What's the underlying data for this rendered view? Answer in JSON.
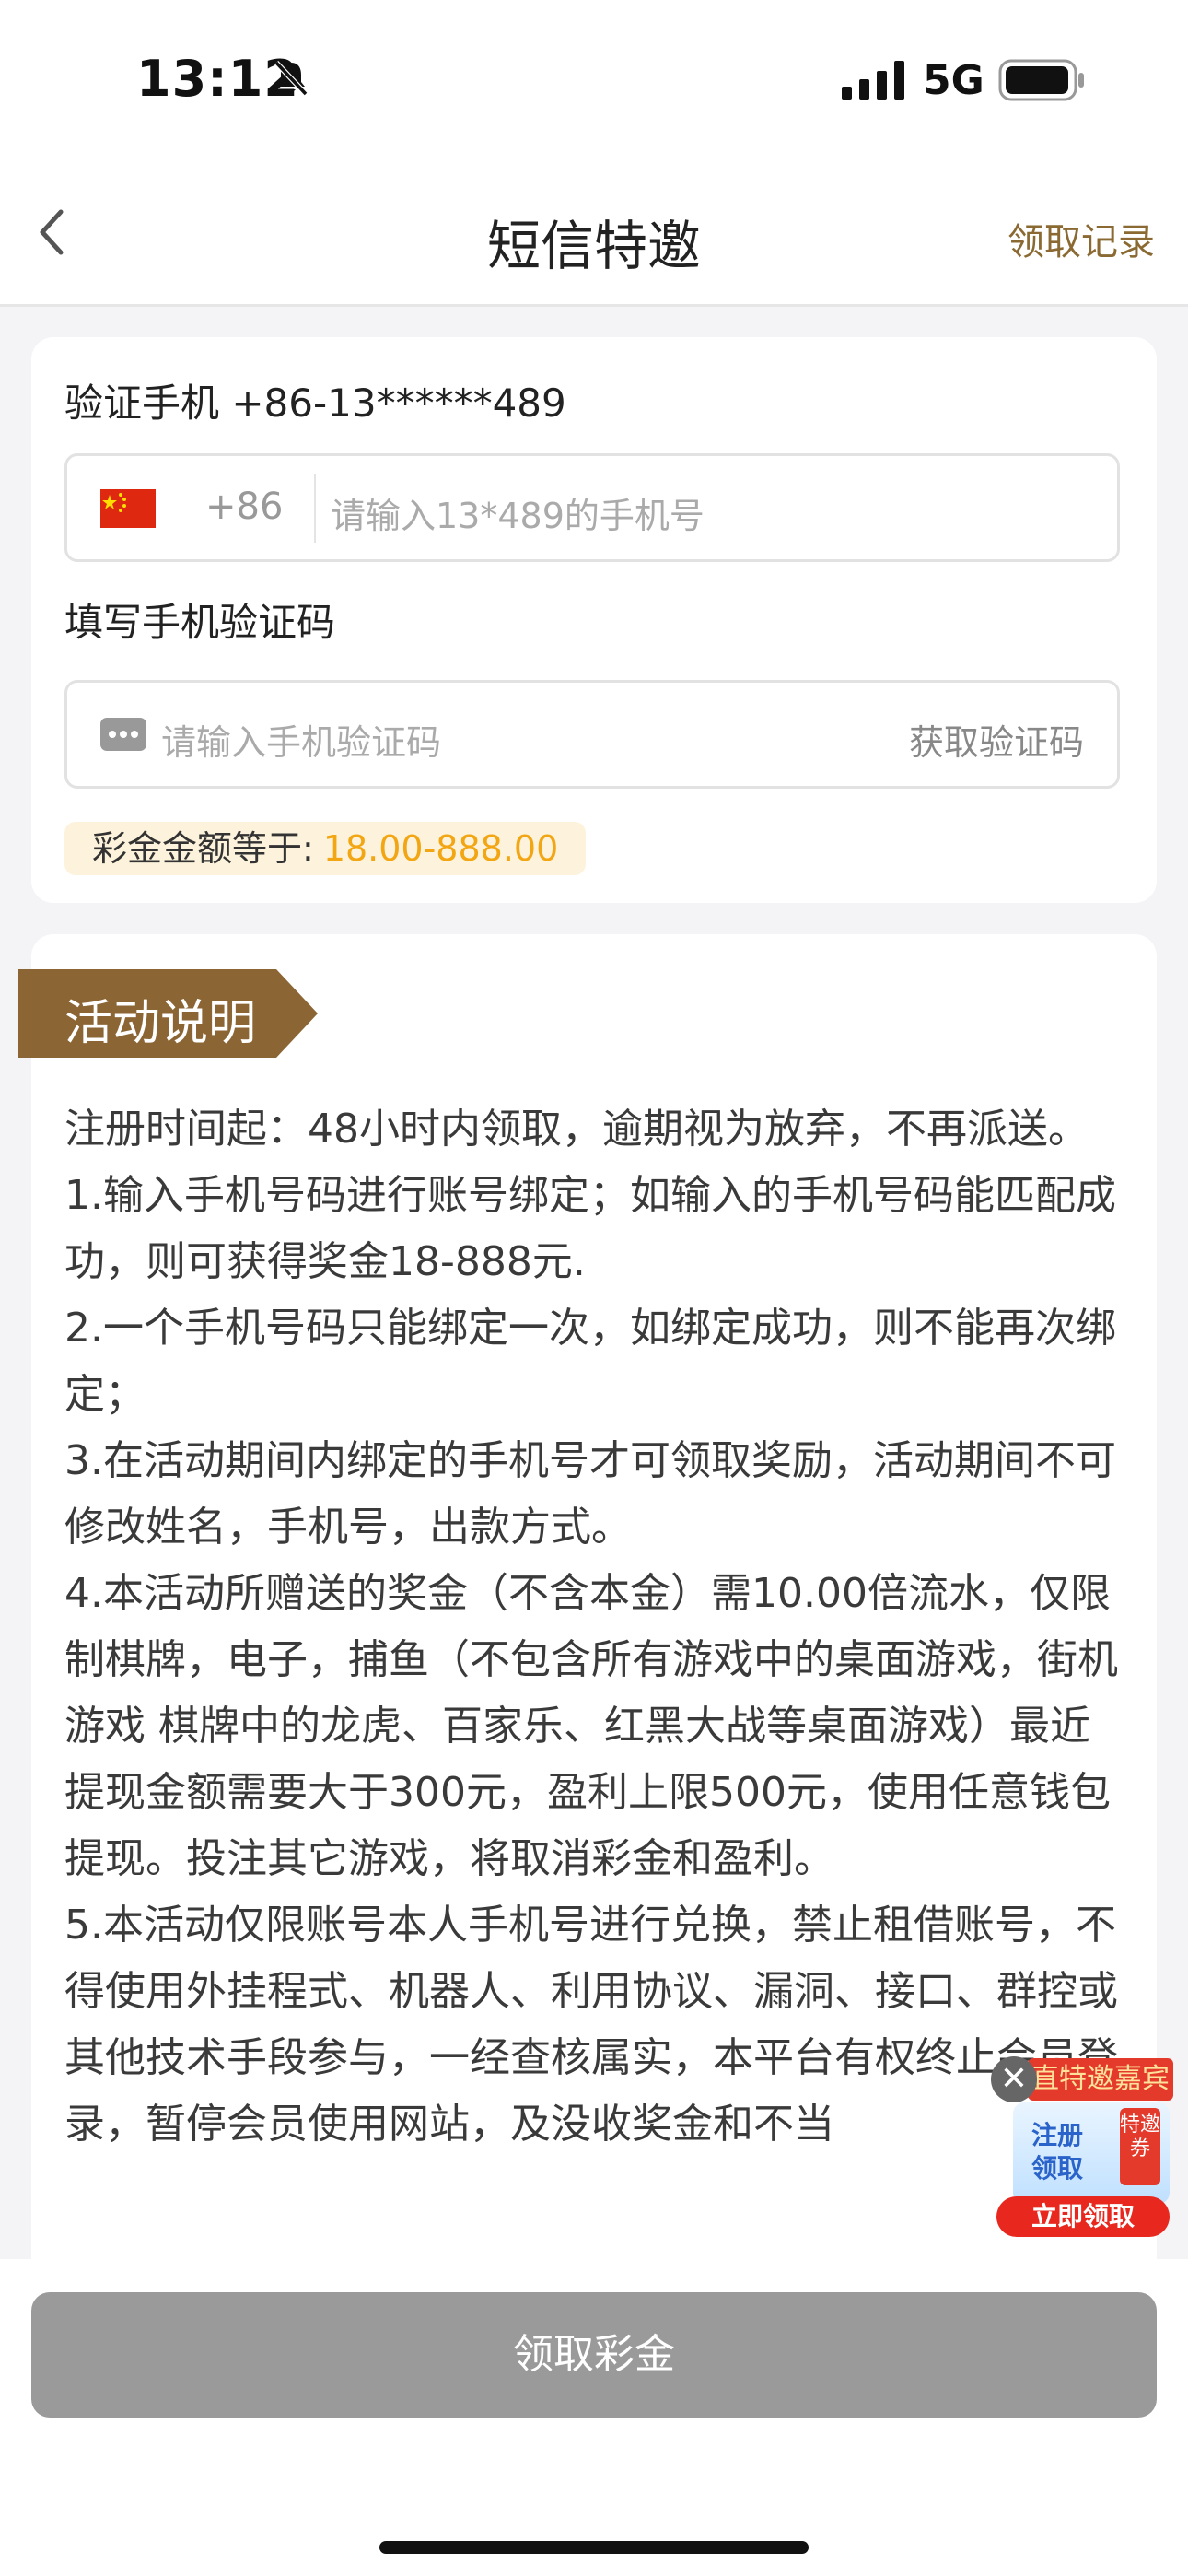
{
  "status_bar": {
    "time": "13:12",
    "network": "5G"
  },
  "nav": {
    "title": "短信特邀",
    "right_link": "领取记录"
  },
  "form": {
    "verify_label": "验证手机 +86-13******489",
    "country_code": "+86",
    "phone_placeholder": "请输入13*489的手机号",
    "code_label": "填写手机验证码",
    "code_placeholder": "请输入手机验证码",
    "get_code": "获取验证码",
    "amount_label": "彩金金额等于:",
    "amount_value": "18.00-888.00"
  },
  "description": {
    "title": "活动说明",
    "paragraphs": [
      "注册时间起：48小时内领取，逾期视为放弃，不再派送。",
      "1.输入手机号码进行账号绑定；如输入的手机号码能匹配成功，则可获得奖金18-888元.",
      "2.一个手机号码只能绑定一次，如绑定成功，则不能再次绑定；",
      "3.在活动期间内绑定的手机号才可领取奖励，活动期间不可修改姓名，手机号，出款方式。",
      "4.本活动所赠送的奖金（不含本金）需10.00倍流水，仅限制棋牌，电子，捕鱼（不包含所有游戏中的桌面游戏，街机游戏 棋牌中的龙虎、百家乐、红黑大战等桌面游戏）最近提现金额需要大于300元，盈利上限500元，使用任意钱包提现。投注其它游戏，将取消彩金和盈利。",
      "5.本活动仅限账号本人手机号进行兑换，禁止租借账号，不得使用外挂程式、机器人、利用协议、漏洞、接口、群控或其他技术手段参与，一经查核属实，本平台有权终止会员登录，暂停会员使用网站，及没收奖金和不当"
    ]
  },
  "badge": {
    "close": "✕",
    "top_text": "直特邀嘉宾",
    "line1": "注册",
    "line2": "领取",
    "tag": "特邀券",
    "button": "立即领取"
  },
  "footer": {
    "button": "领取彩金"
  },
  "colors": {
    "accent_brown": "#8a6a32",
    "amount_highlight": "#f3a614",
    "disabled_button": "#9a9a9a",
    "badge_red": "#e33a2c"
  }
}
